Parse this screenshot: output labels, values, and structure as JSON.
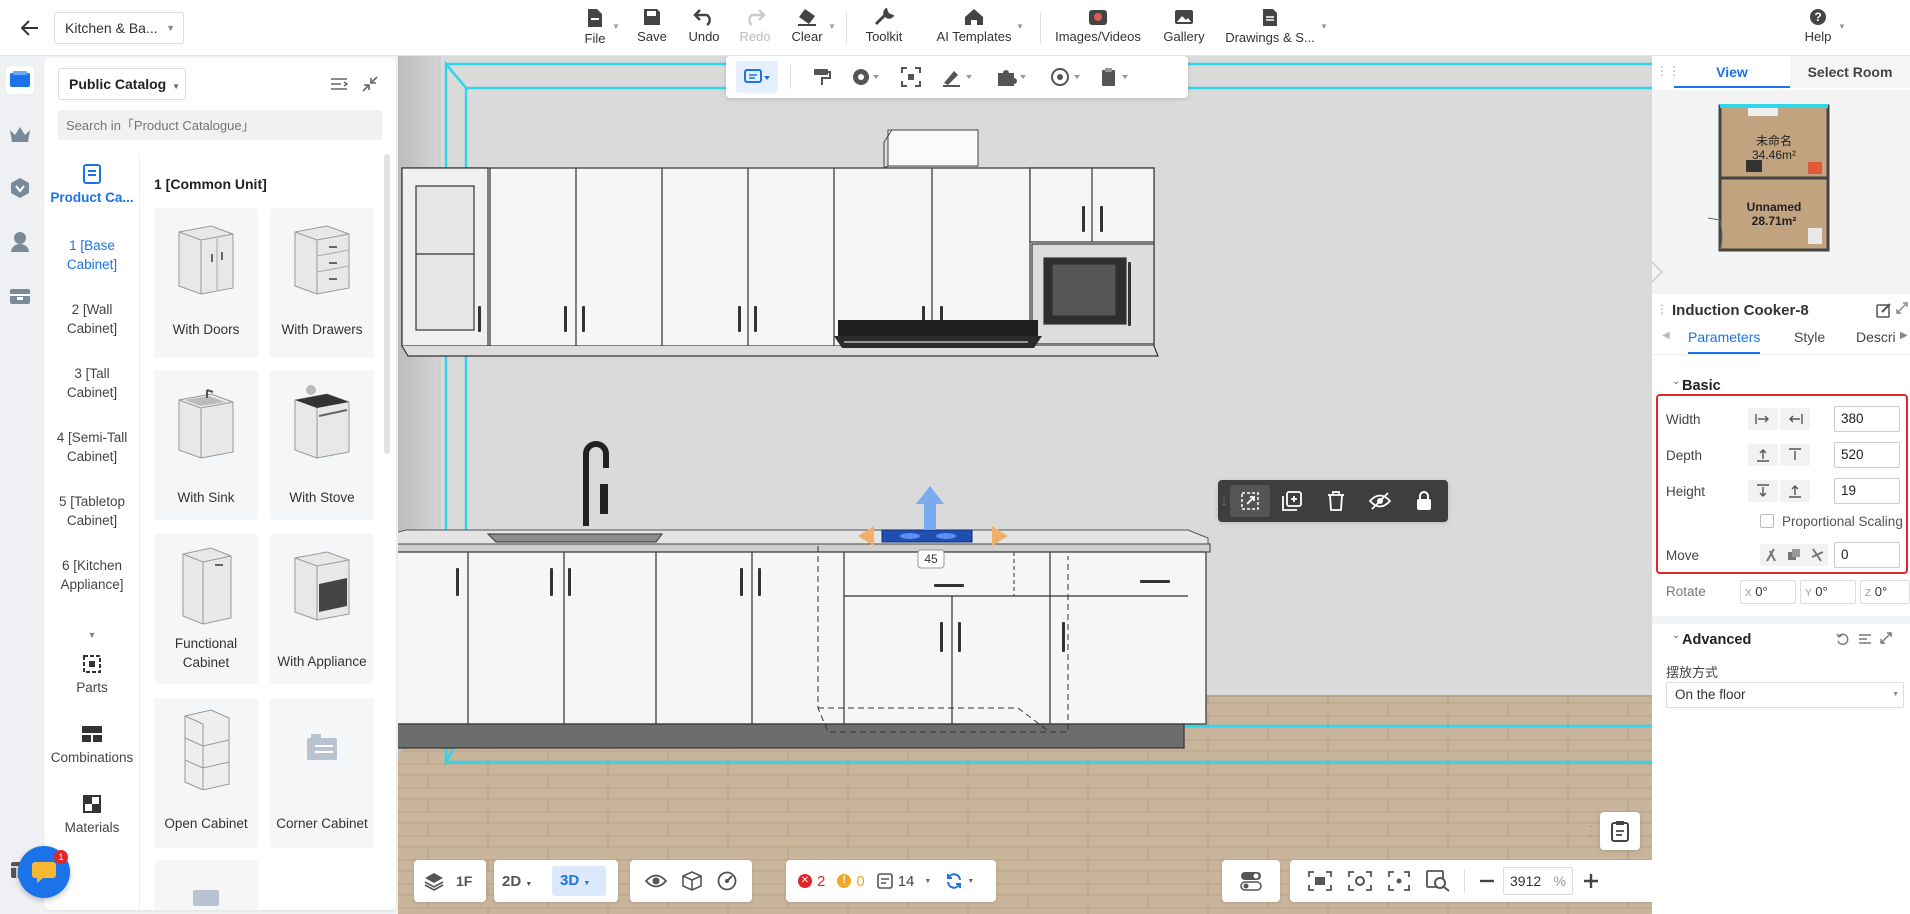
{
  "app": {
    "document_name": "Kitchen & Ba..."
  },
  "toolbar": {
    "file": "File",
    "save": "Save",
    "undo": "Undo",
    "redo": "Redo",
    "clear": "Clear",
    "toolkit": "Toolkit",
    "ai_templates": "AI Templates",
    "images_videos": "Images/Videos",
    "gallery": "Gallery",
    "drawings": "Drawings & S...",
    "help": "Help"
  },
  "catalog": {
    "selector": "Public Catalog",
    "search_placeholder": "Search in「Product Catalogue」",
    "section_title": "1 [Common Unit]",
    "nav": {
      "product_catalog": "Product Ca...",
      "categories": [
        "1 [Base Cabinet]",
        "2 [Wall Cabinet]",
        "3 [Tall Cabinet]",
        "4 [Semi-Tall Cabinet]",
        "5 [Tabletop Cabinet]",
        "6 [Kitchen Appliance]"
      ],
      "parts": "Parts",
      "combinations": "Combinations",
      "materials": "Materials"
    },
    "items": [
      "With Doors",
      "With Drawers",
      "With Sink",
      "With Stove",
      "Functional Cabinet",
      "With Appliance",
      "Open Cabinet",
      "Corner Cabinet"
    ]
  },
  "viewport": {
    "angle_label": "45"
  },
  "right_panel": {
    "tabs": {
      "view": "View",
      "select_room": "Select Room"
    },
    "rooms": [
      {
        "name": "未命名",
        "area": "34.46m²"
      },
      {
        "name": "Unnamed",
        "area": "28.71m²"
      }
    ],
    "object_title": "Induction Cooker-8",
    "subtabs": {
      "parameters": "Parameters",
      "style": "Style",
      "description": "Descri"
    },
    "basic": {
      "heading": "Basic",
      "width_label": "Width",
      "width_value": "380",
      "depth_label": "Depth",
      "depth_value": "520",
      "height_label": "Height",
      "height_value": "19",
      "proportional_scaling": "Proportional Scaling",
      "move_label": "Move",
      "move_value": "0",
      "rotate_label": "Rotate",
      "rotate_x_label": "X",
      "rotate_x": "0°",
      "rotate_y_label": "Y",
      "rotate_y": "0°",
      "rotate_z_label": "Z",
      "rotate_z": "0°"
    },
    "advanced": {
      "heading": "Advanced",
      "placement_label": "摆放方式",
      "placement_value": "On the floor"
    }
  },
  "bottom_bar": {
    "floor": "1F",
    "mode_2d": "2D",
    "mode_3d": "3D",
    "errors": "2",
    "warnings": "0",
    "count": "14",
    "zoom_value": "3912",
    "zoom_unit": "%"
  },
  "notification_badge": "1",
  "colors": {
    "accent": "#1a73e8",
    "highlight_box": "#e0262b",
    "selection_outline": "#2fd5e8"
  }
}
